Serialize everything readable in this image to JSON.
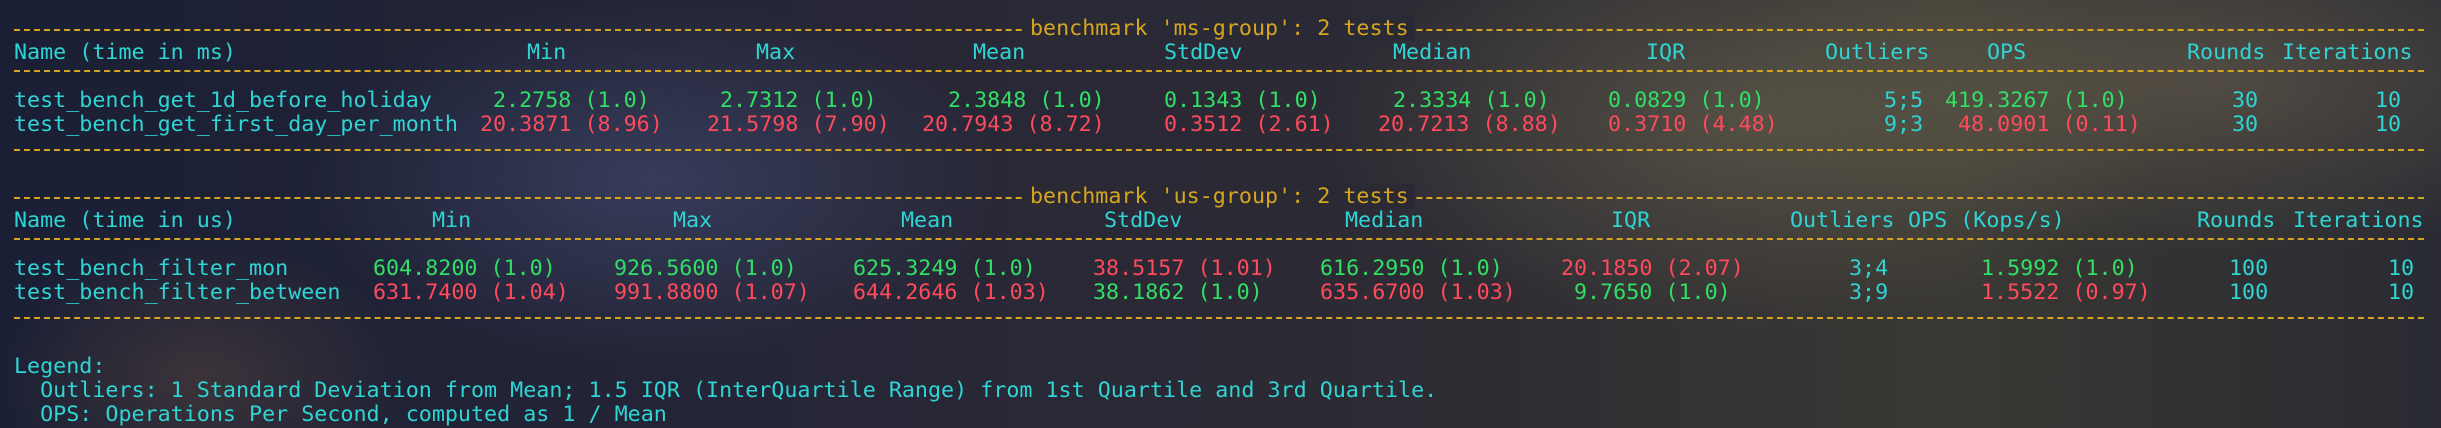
{
  "ms": {
    "title": "benchmark 'ms-group': 2 tests",
    "headers": {
      "name": "Name (time in ms)",
      "min": "Min",
      "max": "Max",
      "mean": "Mean",
      "stddev": "StdDev",
      "median": "Median",
      "iqr": "IQR",
      "outliers": "Outliers",
      "ops": "OPS",
      "rounds": "Rounds",
      "iterations": "Iterations"
    },
    "rows": [
      {
        "name": "test_bench_get_1d_before_holiday",
        "min": "2.2758 (1.0)",
        "max": "2.7312 (1.0)",
        "mean": "2.3848 (1.0)",
        "stddev": "0.1343 (1.0)",
        "median": "2.3334 (1.0)",
        "iqr": "0.0829 (1.0)",
        "outliers": "5;5",
        "ops": "419.3267 (1.0)",
        "rounds": "30",
        "iterations": "10"
      },
      {
        "name": "test_bench_get_first_day_per_month",
        "min": "20.3871 (8.96)",
        "max": "21.5798 (7.90)",
        "mean": "20.7943 (8.72)",
        "stddev": "0.3512 (2.61)",
        "median": "20.7213 (8.88)",
        "iqr": "0.3710 (4.48)",
        "outliers": "9;3",
        "ops": "48.0901 (0.11)",
        "rounds": "30",
        "iterations": "10"
      }
    ]
  },
  "us": {
    "title": "benchmark 'us-group': 2 tests",
    "headers": {
      "name": "Name (time in us)",
      "min": "Min",
      "max": "Max",
      "mean": "Mean",
      "stddev": "StdDev",
      "median": "Median",
      "iqr": "IQR",
      "outliers": "Outliers",
      "ops": "OPS (Kops/s)",
      "rounds": "Rounds",
      "iterations": "Iterations"
    },
    "rows": [
      {
        "name": "test_bench_filter_mon",
        "min": "604.8200 (1.0)",
        "max": "926.5600 (1.0)",
        "mean": "625.3249 (1.0)",
        "stddev": "38.5157 (1.01)",
        "median": "616.2950 (1.0)",
        "iqr": "20.1850 (2.07)",
        "outliers": "3;4",
        "ops": "1.5992 (1.0)",
        "rounds": "100",
        "iterations": "10"
      },
      {
        "name": "test_bench_filter_between",
        "min": "631.7400 (1.04)",
        "max": "991.8800 (1.07)",
        "mean": "644.2646 (1.03)",
        "stddev": "38.1862 (1.0)",
        "median": "635.6700 (1.03)",
        "iqr": "9.7650 (1.0)",
        "outliers": "3;9",
        "ops": "1.5522 (0.97)",
        "rounds": "100",
        "iterations": "10"
      }
    ]
  },
  "legend": {
    "title": "Legend:",
    "outliers": "  Outliers: 1 Standard Deviation from Mean; 1.5 IQR (InterQuartile Range) from 1st Quartile and 3rd Quartile.",
    "ops": "  OPS: Operations Per Second, computed as 1 / Mean"
  },
  "colors": {
    "best": "#30e065",
    "worst": "#ff4a5c",
    "header": "#2fd4d4",
    "rule": "#d6a520"
  }
}
